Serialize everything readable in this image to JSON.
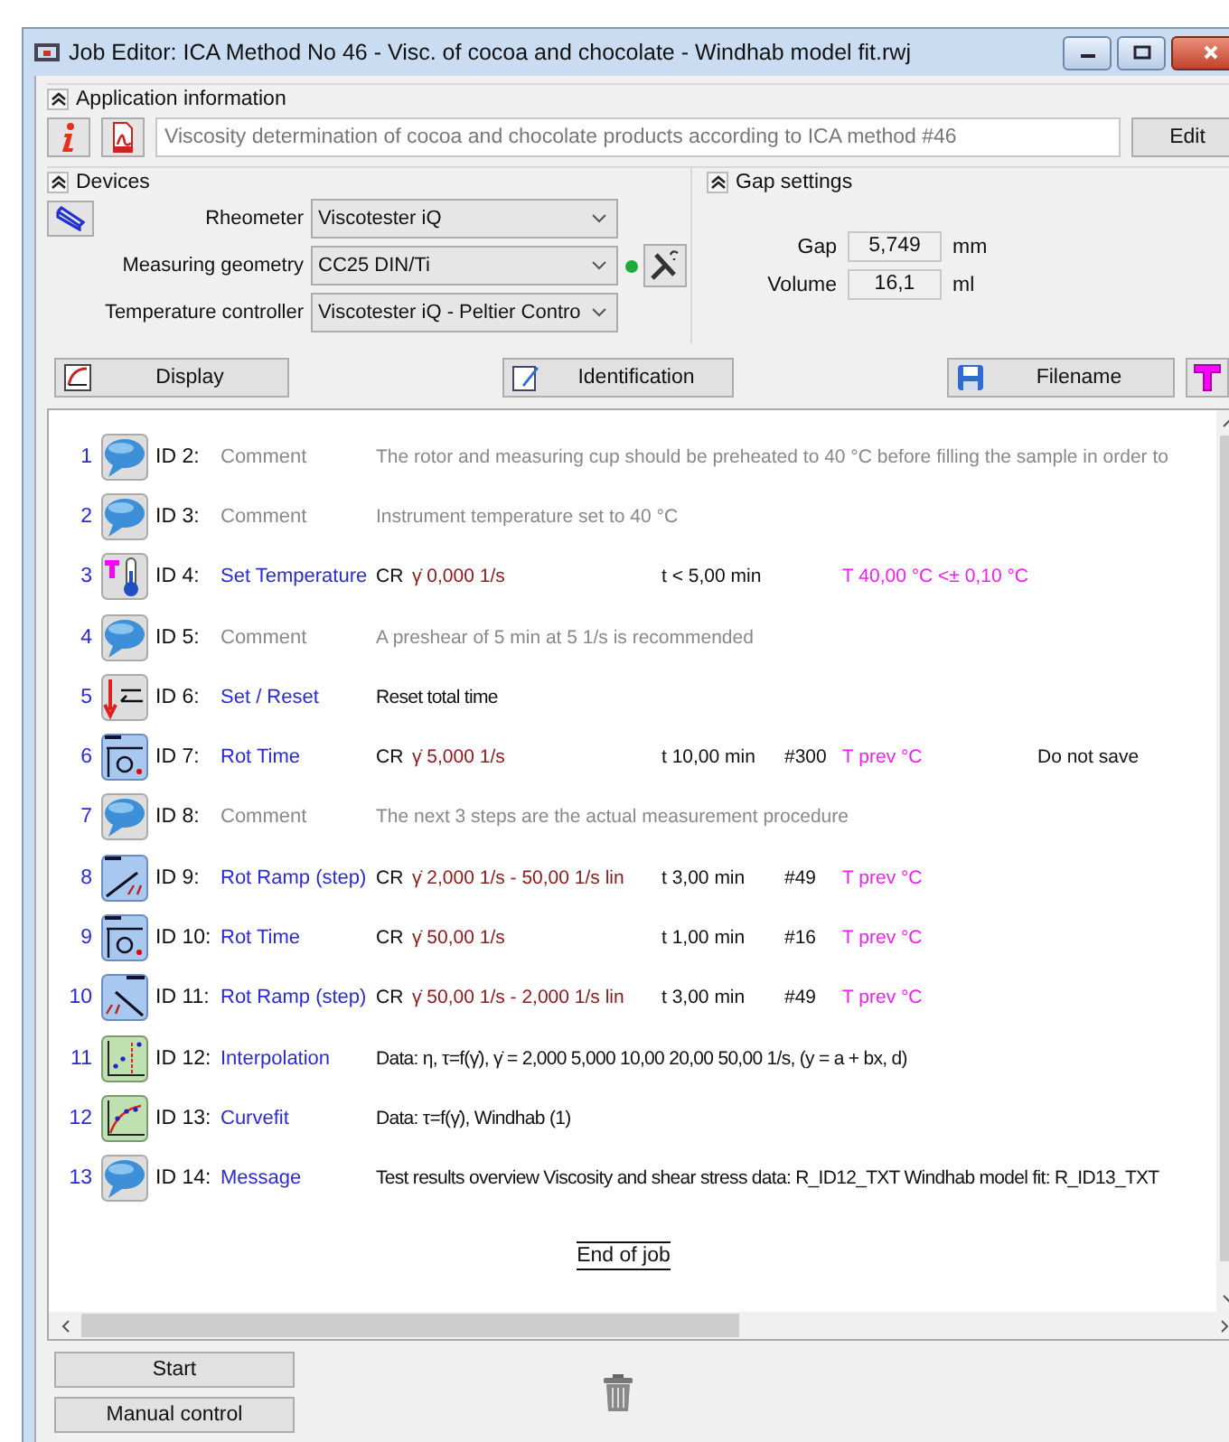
{
  "window": {
    "title": "Job Editor: ICA Method No 46 - Visc. of cocoa and chocolate - Windhab model fit.rwj"
  },
  "application_information": {
    "header": "Application information",
    "description": "Viscosity determination of cocoa and chocolate products according to ICA method #46",
    "edit_button": "Edit"
  },
  "devices": {
    "header": "Devices",
    "fields": [
      {
        "label": "Rheometer",
        "value": "Viscotester iQ",
        "connected": false
      },
      {
        "label": "Measuring geometry",
        "value": "CC25 DIN/Ti",
        "connected": true
      },
      {
        "label": "Temperature controller",
        "value": "Viscotester iQ - Peltier Contro",
        "connected": false
      }
    ]
  },
  "gap_settings": {
    "header": "Gap settings",
    "fields": [
      {
        "label": "Gap",
        "value": "5,749",
        "unit": "mm"
      },
      {
        "label": "Volume",
        "value": "16,1",
        "unit": "ml"
      }
    ]
  },
  "toolbar": [
    {
      "kind": "display",
      "label": "Display"
    },
    {
      "kind": "identification",
      "label": "Identification"
    },
    {
      "kind": "filename",
      "label": "Filename"
    }
  ],
  "steps": [
    {
      "number": "1",
      "kind": "comment",
      "id": "ID 2:",
      "name": "Comment",
      "details": [
        {
          "kind": "comment",
          "text": "The rotor and measuring cup should be preheated to 40 °C before filling the sample in order to"
        }
      ]
    },
    {
      "number": "2",
      "kind": "comment",
      "id": "ID 3:",
      "name": "Comment",
      "details": [
        {
          "kind": "comment",
          "text": "Instrument temperature set to 40 °C"
        }
      ]
    },
    {
      "number": "3",
      "kind": "temperature",
      "id": "ID 4:",
      "name": "Set Temperature",
      "details": [
        {
          "kind": "mode",
          "text": "CR"
        },
        {
          "kind": "rate",
          "text": "γ̇ 0,000 1/s"
        },
        {
          "kind": "time",
          "text": "t < 5,00 min"
        },
        {
          "kind": "temp",
          "text": "T 40,00 °C <± 0,10 °C"
        }
      ]
    },
    {
      "number": "4",
      "kind": "comment",
      "id": "ID 5:",
      "name": "Comment",
      "details": [
        {
          "kind": "comment",
          "text": "A preshear of 5 min at 5 1/s is recommended"
        }
      ]
    },
    {
      "number": "5",
      "kind": "set",
      "id": "ID 6:",
      "name": "Set / Reset",
      "details": [
        {
          "kind": "text",
          "text": "Reset total time"
        }
      ]
    },
    {
      "number": "6",
      "kind": "rottime",
      "id": "ID 7:",
      "name": "Rot Time",
      "details": [
        {
          "kind": "mode",
          "text": "CR"
        },
        {
          "kind": "rate",
          "text": "γ̇ 5,000 1/s"
        },
        {
          "kind": "time",
          "text": "t 10,00 min"
        },
        {
          "kind": "count",
          "text": "#300"
        },
        {
          "kind": "temp",
          "text": "T prev °C"
        },
        {
          "kind": "note",
          "text": "Do not save"
        }
      ]
    },
    {
      "number": "7",
      "kind": "comment",
      "id": "ID 8:",
      "name": "Comment",
      "details": [
        {
          "kind": "comment",
          "text": "The next 3 steps are the actual measurement procedure"
        }
      ]
    },
    {
      "number": "8",
      "kind": "rampup",
      "id": "ID 9:",
      "name": "Rot Ramp (step)",
      "details": [
        {
          "kind": "mode",
          "text": "CR"
        },
        {
          "kind": "rate",
          "text": "γ̇ 2,000 1/s - 50,00 1/s lin"
        },
        {
          "kind": "time",
          "text": "t 3,00 min"
        },
        {
          "kind": "count",
          "text": "#49"
        },
        {
          "kind": "temp",
          "text": "T prev °C"
        }
      ]
    },
    {
      "number": "9",
      "kind": "rottime",
      "id": "ID 10:",
      "name": "Rot Time",
      "details": [
        {
          "kind": "mode",
          "text": "CR"
        },
        {
          "kind": "rate",
          "text": "γ̇ 50,00 1/s"
        },
        {
          "kind": "time",
          "text": "t 1,00 min"
        },
        {
          "kind": "count",
          "text": "#16"
        },
        {
          "kind": "temp",
          "text": "T prev °C"
        }
      ]
    },
    {
      "number": "10",
      "kind": "rampdown",
      "id": "ID 11:",
      "name": "Rot Ramp (step)",
      "details": [
        {
          "kind": "mode",
          "text": "CR"
        },
        {
          "kind": "rate",
          "text": "γ̇ 50,00 1/s - 2,000 1/s lin"
        },
        {
          "kind": "time",
          "text": "t 3,00 min"
        },
        {
          "kind": "count",
          "text": "#49"
        },
        {
          "kind": "temp",
          "text": "T prev °C"
        }
      ]
    },
    {
      "number": "11",
      "kind": "interpolation",
      "id": "ID 12:",
      "name": "Interpolation",
      "details": [
        {
          "kind": "text",
          "text": "Data: η, τ=f(γ̇),  γ̇ = 2,000 5,000 10,00 20,00 50,00 1/s,  (y = a + bx, d)"
        }
      ]
    },
    {
      "number": "12",
      "kind": "curvefit",
      "id": "ID 13:",
      "name": "Curvefit",
      "details": [
        {
          "kind": "text",
          "text": "Data: τ=f(γ̇), Windhab (1)"
        }
      ]
    },
    {
      "number": "13",
      "kind": "message",
      "id": "ID 14:",
      "name": "Message",
      "details": [
        {
          "kind": "text",
          "text": "Test results overview Viscosity and shear stress data: R_ID12_TXT Windhab model fit: R_ID13_TXT"
        }
      ]
    }
  ],
  "end_of_job": "End of job",
  "buttons": [
    "Start",
    "Manual control"
  ]
}
